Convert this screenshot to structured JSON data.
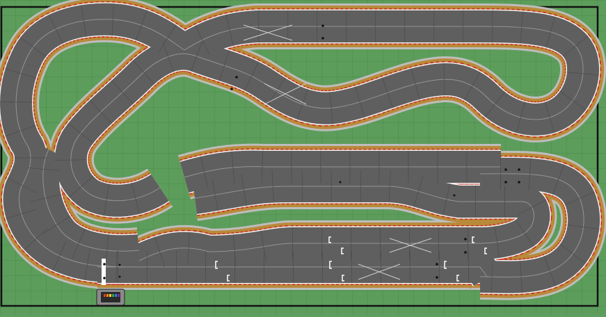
{
  "app": {
    "title": ""
  },
  "colors": {
    "grass": "#5d9d5c",
    "grid": "#4a8a4a",
    "border": "#111111",
    "asphalt": "#5f5f5f",
    "asphalt_dark": "#4e4e4e",
    "shoulder": "#b88a3a",
    "barrier": "#bdbdbd",
    "kerb_red": "#cc2222",
    "kerb_white": "#f2f2f2",
    "lane_line": "#9a9a9a",
    "start_line": "#ffffff",
    "controller_body": "#8a8a8a"
  },
  "track": {
    "lanes": 2,
    "has_grid": true,
    "has_start_finish": true,
    "has_lap_counter": true
  },
  "controller": {
    "icon": "lap-counter-icon",
    "lights": [
      "#e53935",
      "#fb8c00",
      "#fdd835",
      "#43a047",
      "#1e88e5",
      "#8e24aa"
    ]
  }
}
